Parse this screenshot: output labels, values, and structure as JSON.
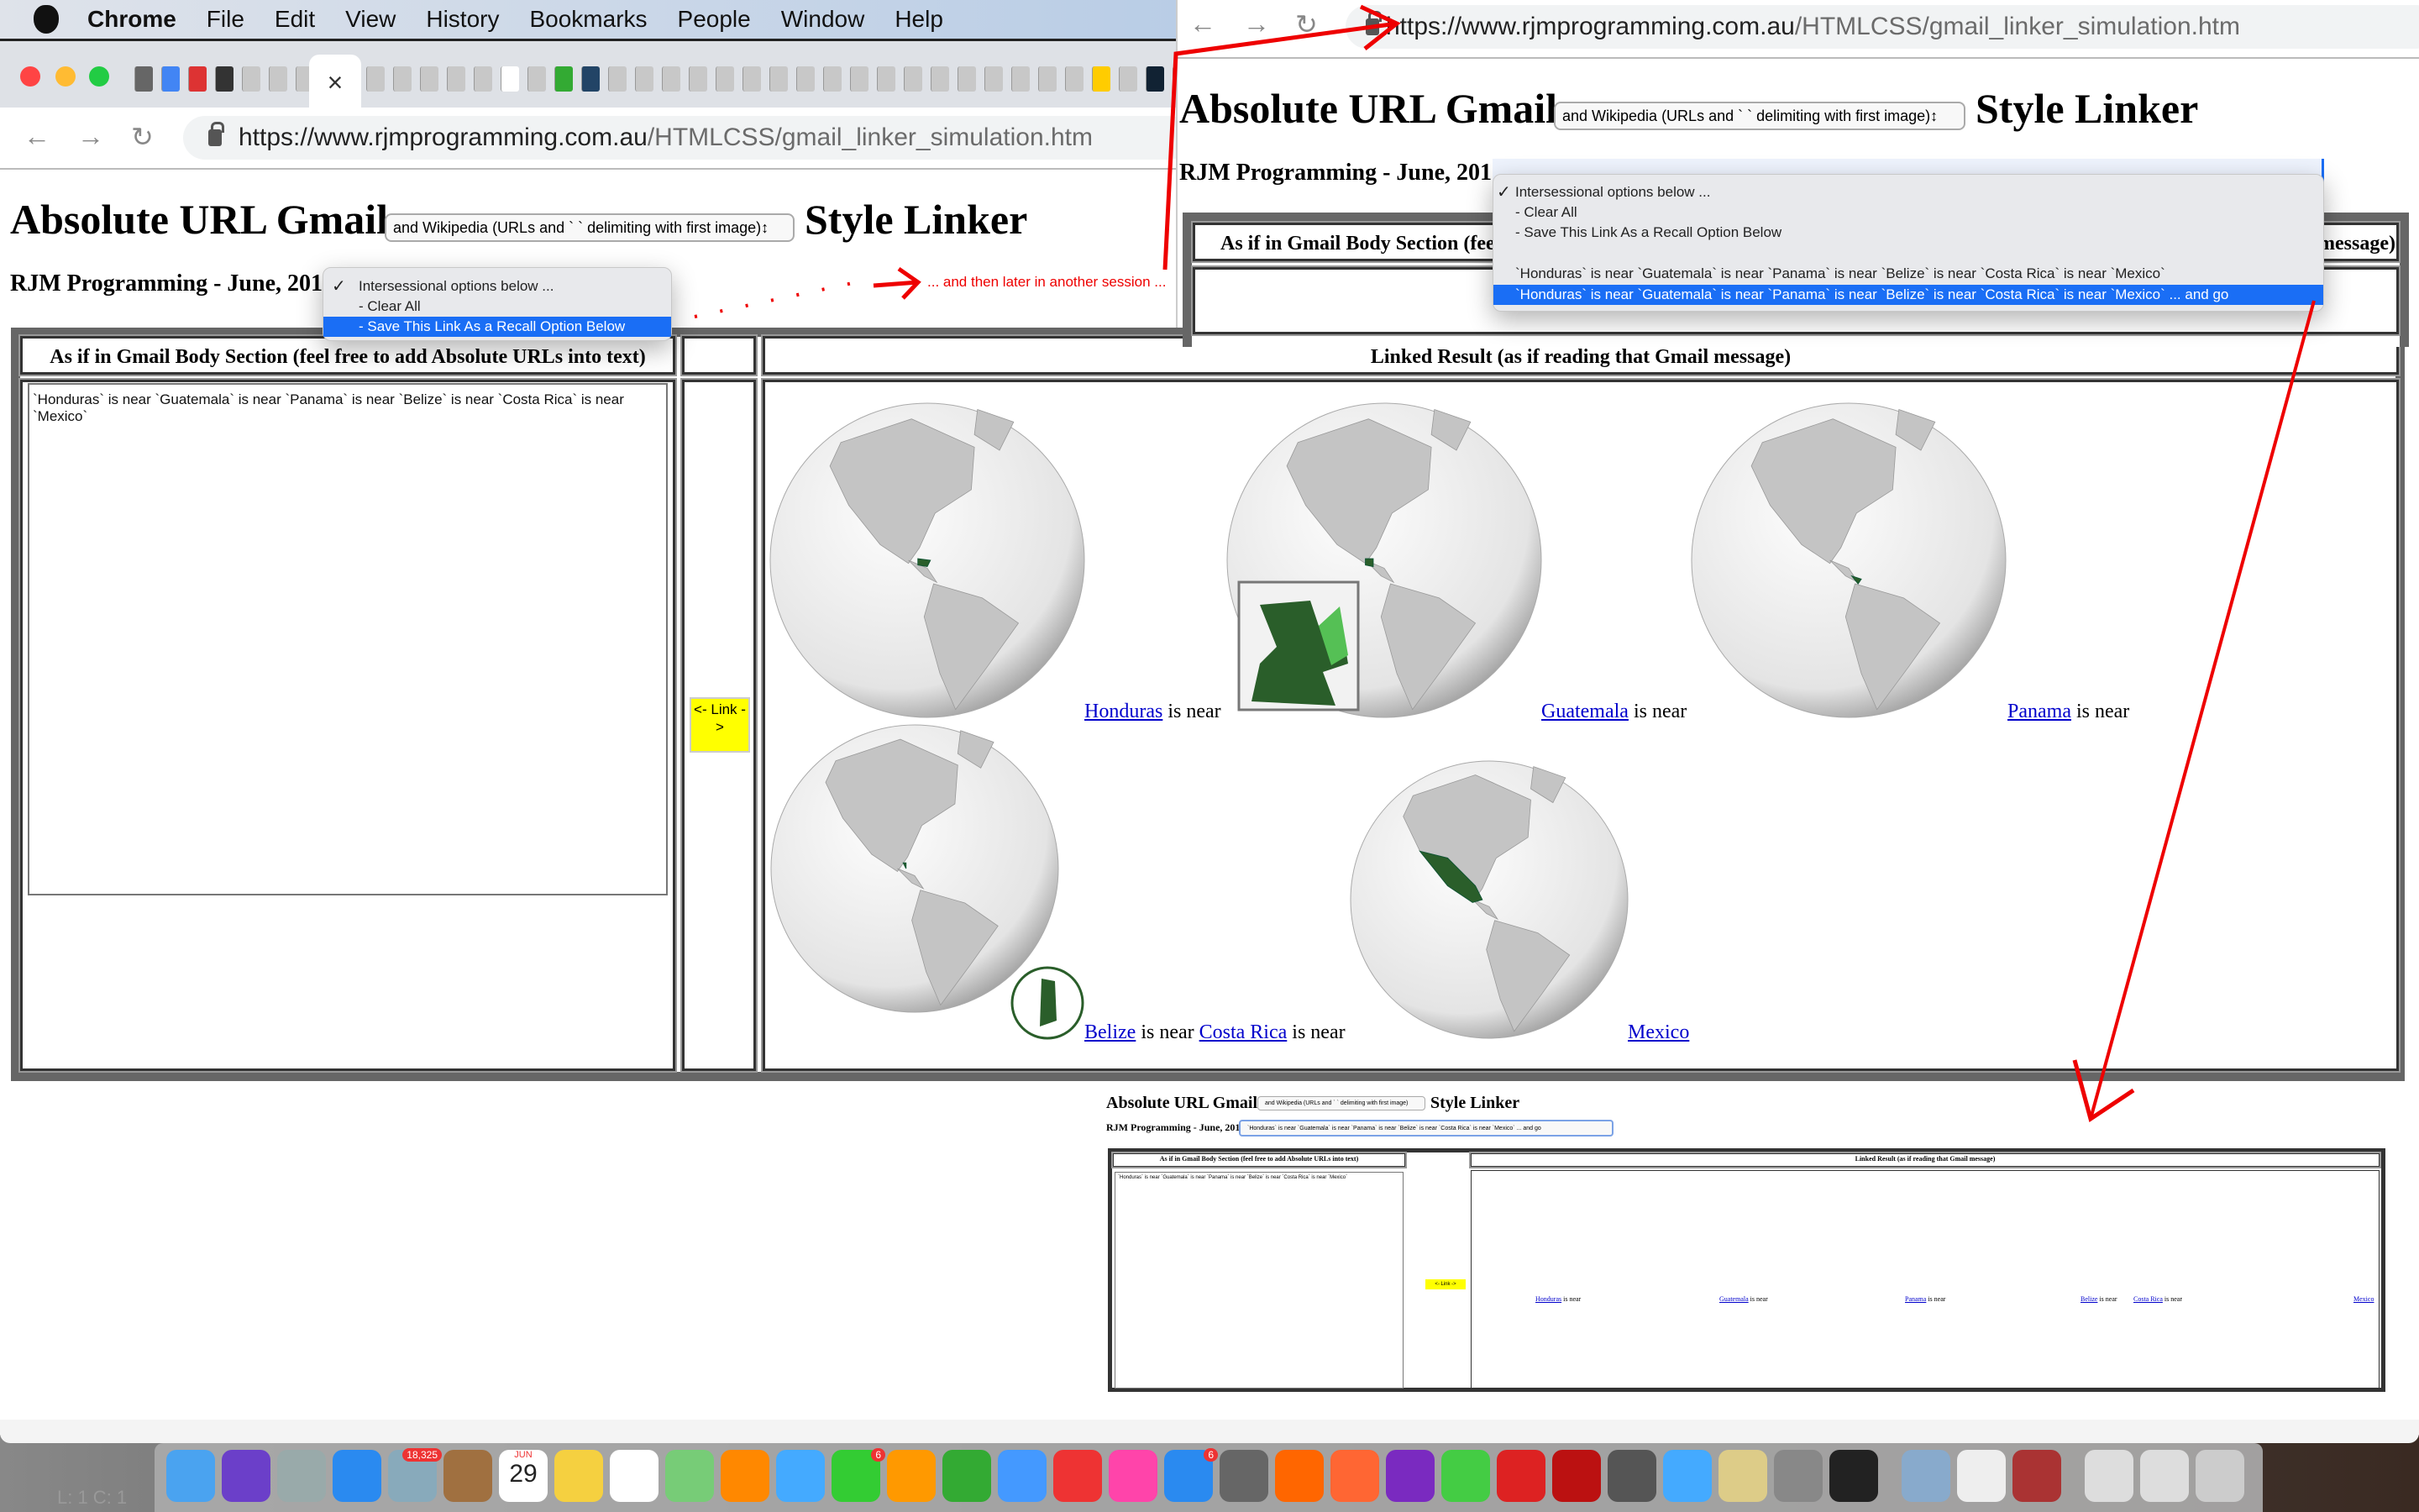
{
  "menubar": {
    "app": "Chrome",
    "items": [
      "File",
      "Edit",
      "View",
      "History",
      "Bookmarks",
      "People",
      "Window",
      "Help"
    ]
  },
  "browser_left": {
    "tab_close": "×",
    "url_host": "https://www.rjmprogramming.com.au",
    "url_path": "/HTMLCSS/gmail_linker_simulation.htm",
    "nav": {
      "back": "←",
      "forward": "→",
      "reload": "↻"
    }
  },
  "page": {
    "title_left": "Absolute URL Gmail",
    "mode_select": "and Wikipedia (URLs and ` ` delimiting with first image)",
    "title_right": "Style Linker",
    "subtitle_cut": "RJM Programming - June, 201",
    "subtitle_full": "RJM Programming - June, 2019",
    "left_header": "As if in Gmail Body Section (feel free to add Absolute URLs into text)",
    "right_header": "Linked Result (as if reading that Gmail message)",
    "textarea": "`Honduras` is near `Guatemala` is near `Panama` is near `Belize` is near `Costa Rica` is near `Mexico`",
    "link_button": "<- Link ->",
    "results": [
      {
        "country": "Honduras",
        "suffix": " is near"
      },
      {
        "country": "Guatemala",
        "suffix": " is near"
      },
      {
        "country": "Panama",
        "suffix": " is near"
      },
      {
        "country": "Belize",
        "suffix": " is near "
      },
      {
        "country": "Costa Rica",
        "suffix": " is near"
      },
      {
        "country": "Mexico",
        "suffix": ""
      }
    ]
  },
  "dropdown_left": {
    "options": [
      {
        "label": "Intersessional options below ...",
        "checked": true
      },
      {
        "label": "- Clear All"
      },
      {
        "label": "- Save This Link As a Recall Option Below",
        "highlighted": true
      }
    ]
  },
  "annotation": "... and then later in another session ...",
  "browser_right": {
    "url_host": "https://www.rjmprogramming.com.au",
    "url_path": "/HTMLCSS/gmail_linker_simulation.htm",
    "left_header_visible": "As if in Gmail Body Section (fee",
    "right_header_visible": "message)",
    "options": [
      {
        "label": "Intersessional options below ...",
        "checked": true
      },
      {
        "label": "- Clear All"
      },
      {
        "label": "- Save This Link As a Recall Option Below"
      },
      {
        "label": "`Honduras` is near `Guatemala` is near `Panama` is near `Belize` is near `Costa Rica` is near `Mexico`"
      },
      {
        "label": "`Honduras` is near `Guatemala` is near `Panama` is near `Belize` is near `Costa Rica` is near `Mexico` ... and go",
        "highlighted": true
      }
    ]
  },
  "mini": {
    "recall_select": "`Honduras` is near `Guatemala` is near `Panama` is near `Belize` is near `Costa Rica` is near `Mexico` ... and go",
    "link_button": "<- Link ->"
  },
  "dock": {
    "icons": [
      "finder",
      "siri",
      "launchpad",
      "safari",
      "mail",
      "notes-brown",
      "calendar",
      "stickies",
      "reminders",
      "maps",
      "photos",
      "messages",
      "facetime",
      "pages",
      "numbers",
      "keynote",
      "news",
      "music",
      "app-store",
      "system-preferences",
      "avast",
      "firefox",
      "phpstorm",
      "chrome",
      "opera",
      "filezilla",
      "sequel",
      "wireshark",
      "brush",
      "gimp",
      "terminal",
      "preview",
      "textedit",
      "photo-booth",
      "html-doc",
      "screen",
      "trash"
    ],
    "badges": {
      "mail": "18,325",
      "facetime": "6",
      "app-store": "6"
    },
    "calendar": {
      "month": "JUN",
      "day": "29"
    }
  },
  "status": "L: 1 C: 1",
  "colors": {
    "accent": "#1a6ef5",
    "annotation": "#e00000",
    "link_button": "#ffff00",
    "highlight_country": "#2a5e2a"
  }
}
